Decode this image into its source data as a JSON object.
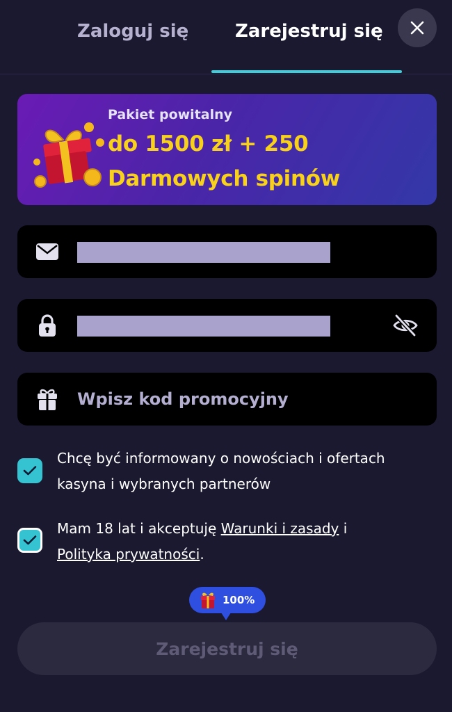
{
  "tabs": {
    "login": "Zaloguj się",
    "register": "Zarejestruj się",
    "active": "register"
  },
  "banner": {
    "small": "Pakiet powitalny",
    "line1": "do 1500 zł + 250",
    "line2": "Darmowych spinów",
    "icon": "gift-box-icon"
  },
  "fields": {
    "email": {
      "icon": "envelope-icon"
    },
    "password": {
      "icon": "lock-icon",
      "toggle_icon": "eye-slash-icon"
    },
    "promo": {
      "icon": "gift-icon",
      "placeholder": "Wpisz kod promocyjny"
    }
  },
  "consents": {
    "marketing": {
      "checked": true,
      "text": "Chcę być informowany o nowościach i ofertach kasyna i wybranych partnerów"
    },
    "terms": {
      "checked": true,
      "prefix": "Mam 18 lat i akceptuję ",
      "terms_link": "Warunki i zasady",
      "middle": " i ",
      "privacy_link": "Polityka prywatności",
      "suffix": "."
    }
  },
  "progress_badge": {
    "label": "100%",
    "value": 1.0,
    "icon": "gift-box-icon"
  },
  "submit": {
    "label": "Zarejestruj się"
  },
  "colors": {
    "background": "#1b1930",
    "accent": "#3ecdd9",
    "banner_text": "#f7d11c",
    "badge": "#2f4fe0"
  }
}
